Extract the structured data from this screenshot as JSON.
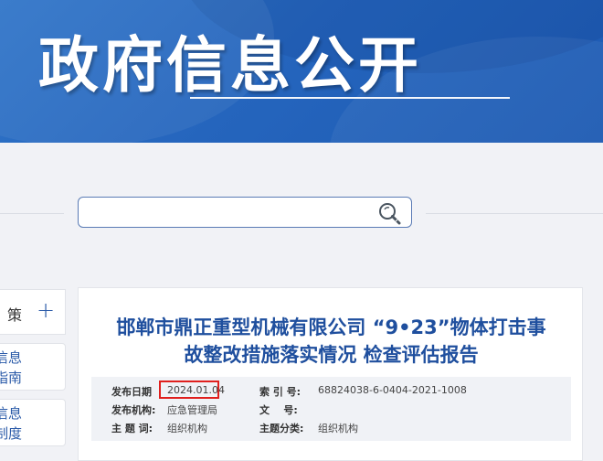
{
  "banner": {
    "title": "政府信息公开"
  },
  "search": {
    "value": "",
    "placeholder": ""
  },
  "sidebar": {
    "policy_label": "策",
    "plus_symbol": "+",
    "guide": {
      "line1": "信息",
      "line2": "指南"
    },
    "system": {
      "line1": "信息",
      "line2": "制度"
    }
  },
  "document": {
    "title_line1": "邯郸市鼎正重型机械有限公司 “9•23”物体打击事",
    "title_line2": "故整改措施落实情况 检查评估报告",
    "meta": {
      "publish_date_label": "发布日期",
      "publish_date": "2024.01.04",
      "publisher_label": "发布机构:",
      "publisher": "应急管理局",
      "topic_label": "主 题 词:",
      "topic": "组织机构",
      "index_label": "索 引 号:",
      "index": "68824038-6-0404-2021-1008",
      "doc_no_label": "文    号:",
      "doc_no": "",
      "category_label": "主题分类:",
      "category": "组织机构"
    }
  },
  "colors": {
    "banner_blue": "#2565bd",
    "title_blue": "#1f4f9e",
    "highlight_red": "#e0201e"
  }
}
